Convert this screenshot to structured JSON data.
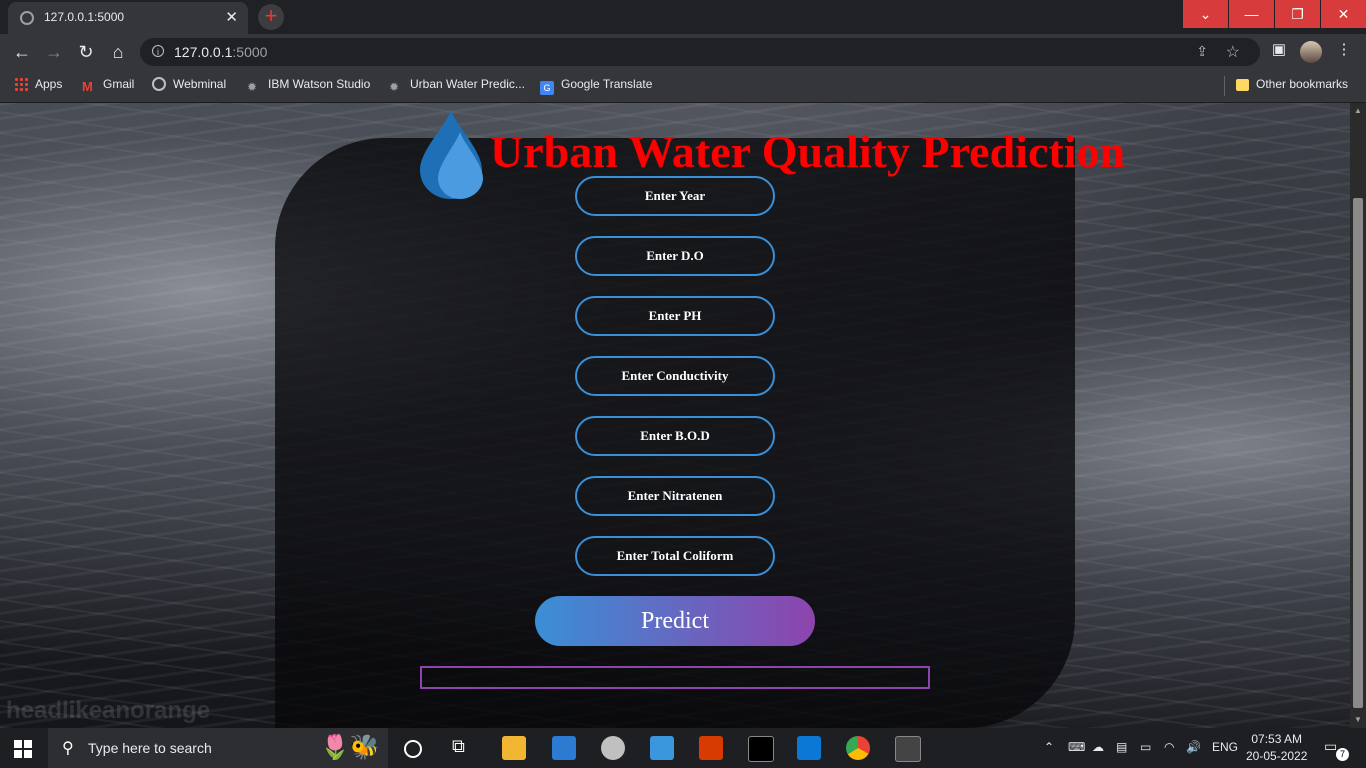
{
  "browser": {
    "tab_title": "127.0.0.1:5000",
    "tab_close": "✕",
    "new_tab": "+",
    "url_host": "127.0.0.1",
    "url_port": ":5000",
    "bookmarks": [
      "Apps",
      "Gmail",
      "Webminal",
      "IBM Watson Studio",
      "Urban Water Predic...",
      "Google Translate"
    ],
    "other_bookmarks": "Other bookmarks"
  },
  "page": {
    "title": "Urban Water Quality Prediction",
    "fields": [
      {
        "placeholder": "Enter Year"
      },
      {
        "placeholder": "Enter D.O"
      },
      {
        "placeholder": "Enter PH"
      },
      {
        "placeholder": "Enter Conductivity"
      },
      {
        "placeholder": "Enter B.O.D"
      },
      {
        "placeholder": "Enter Nitratenen"
      },
      {
        "placeholder": "Enter Total Coliform"
      }
    ],
    "predict_label": "Predict",
    "result_text": "",
    "watermark": "headlikeanorange"
  },
  "taskbar": {
    "search_placeholder": "Type here to search",
    "language": "ENG",
    "time": "07:53 AM",
    "date": "20-05-2022",
    "notification_count": "7"
  },
  "colors": {
    "title": "#ff0000",
    "field_border": "#3a8fd6",
    "button_gradient_start": "#3a8fd6",
    "button_gradient_end": "#8e44ad",
    "result_border": "#8e44ad",
    "window_close": "#d83b3b"
  },
  "icons": [
    "globe-icon",
    "close-icon",
    "plus-icon",
    "back-icon",
    "forward-icon",
    "reload-icon",
    "home-icon",
    "info-icon",
    "share-icon",
    "star-icon",
    "sidebar-icon",
    "menu-icon",
    "water-drop-icon",
    "windows-start-icon",
    "search-icon"
  ]
}
